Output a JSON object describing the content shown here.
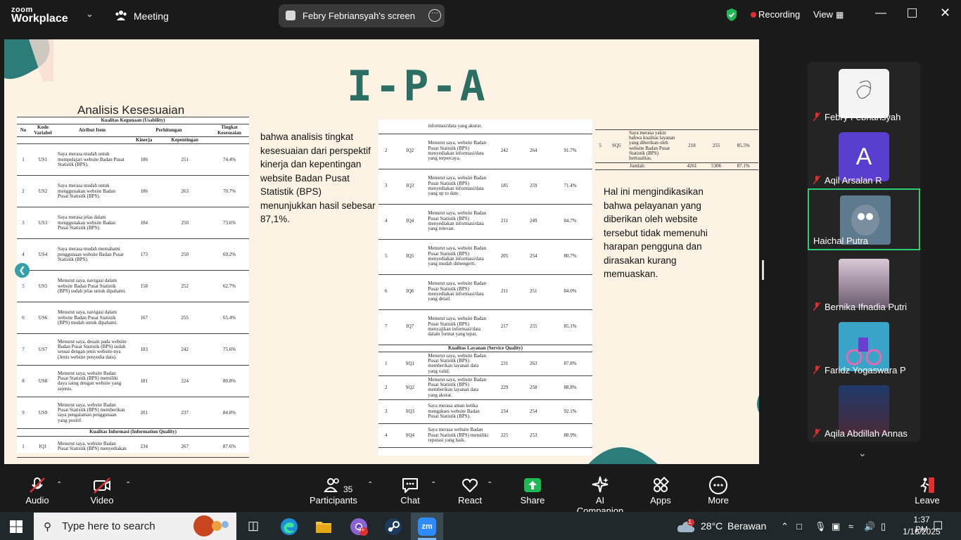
{
  "app": {
    "logo_top": "zoom",
    "logo_bottom": "Workplace",
    "meeting_label": "Meeting",
    "share_label": "Febry Febriansyah's screen",
    "recording_label": "Recording",
    "view_label": "View"
  },
  "slide": {
    "title": "I-P-A",
    "subtitle": "Analisis Kesesuaian",
    "text_left": "bahwa analisis tingkat kesesuaian dari perspektif kinerja dan kepentingan website Badan Pusat Statistik (BPS) menunjukkan hasil sebesar 87,1%.",
    "text_right": "Hal ini mengindikasikan bahwa pelayanan yang diberikan oleh website tersebut tidak memenuhi harapan pengguna dan dirasakan kurang memuaskan.",
    "table1": {
      "section_title": "Kualitas Kegunaan (Usability)",
      "headers": [
        "No",
        "Kode Variabel",
        "Atribut Item",
        "Perhitungan",
        "Tingkat Kesesuaian"
      ],
      "subheaders": [
        "Kinerja",
        "Kepentingan"
      ],
      "rows": [
        {
          "no": "1",
          "code": "US1",
          "item": "Saya merasa mudah untuk mempelajari website Badan Pusat Statistik (BPS).",
          "k": "186",
          "p": "251",
          "t": "74.4%"
        },
        {
          "no": "2",
          "code": "US2",
          "item": "Saya merasa mudah untuk menggunakan website Badan Pusat Statistik (BPS).",
          "k": "186",
          "p": "263",
          "t": "70.7%"
        },
        {
          "no": "3",
          "code": "US3",
          "item": "Saya merasa jelas dalam menggunakan website Badan Pusat Statistik (BPS).",
          "k": "184",
          "p": "250",
          "t": "73.6%"
        },
        {
          "no": "4",
          "code": "US4",
          "item": "Saya merasa mudah memahami penggunaan website Badan Pusat Statistik (BPS).",
          "k": "173",
          "p": "250",
          "t": "69.2%"
        },
        {
          "no": "5",
          "code": "US5",
          "item": "Menurut saya, navigasi dalam website Badan Pusat Statistik (BPS) sudah jelas untuk dipahami.",
          "k": "158",
          "p": "252",
          "t": "62.7%"
        },
        {
          "no": "6",
          "code": "US6",
          "item": "Menurut saya, navigasi dalam website Badan Pusat Statistik (BPS) mudah untuk dipahami.",
          "k": "167",
          "p": "255",
          "t": "65.4%"
        },
        {
          "no": "7",
          "code": "US7",
          "item": "Menurut saya, desain pada website Badan Pusat Statistik (BPS) sudah sesuai dengan jenis website-nya (Jenis website penyedia data).",
          "k": "183",
          "p": "242",
          "t": "75.6%"
        },
        {
          "no": "8",
          "code": "US8",
          "item": "Menurut saya, website Badan Pusat Statistik (BPS) memiliki daya saing dengan website yang sejenis.",
          "k": "181",
          "p": "224",
          "t": "80.8%"
        },
        {
          "no": "9",
          "code": "US9",
          "item": "Menurut saya, website Badan Pusat Statistik (BPS) memberikan saya pengalaman penggunaan yang positif.",
          "k": "201",
          "p": "237",
          "t": "84.8%"
        }
      ],
      "section2_title": "Kualitas Informasi (Information Quality)",
      "rows2": [
        {
          "no": "1",
          "code": "IQ1",
          "item": "Menurut saya, website Badan Pusat Statistik (BPS) menyediakan",
          "k": "234",
          "p": "267",
          "t": "87.6%"
        }
      ]
    },
    "table2": {
      "top_fragment": "informasi/data yang akurat.",
      "rows": [
        {
          "no": "2",
          "code": "IQ2",
          "item": "Menurut saya, website Badan Pusat Statistik (BPS) menyediakan informasi/data yang terpercaya.",
          "k": "242",
          "p": "264",
          "t": "91.7%"
        },
        {
          "no": "3",
          "code": "IQ3",
          "item": "Menurut saya, website Badan Pusat Statistik (BPS) menyediakan informasi/data yang up to date.",
          "k": "185",
          "p": "259",
          "t": "71.4%"
        },
        {
          "no": "4",
          "code": "IQ4",
          "item": "Menurut saya, website Badan Pusat Statistik (BPS) menyediakan informasi/data yang relevan.",
          "k": "211",
          "p": "249",
          "t": "84.7%"
        },
        {
          "no": "5",
          "code": "IQ5",
          "item": "Menurut saya, website Badan Pusat Statistik (BPS) menyediakan informasi/data yang mudah dimengerti.",
          "k": "205",
          "p": "254",
          "t": "80.7%"
        },
        {
          "no": "6",
          "code": "IQ6",
          "item": "Menurut saya, website Badan Pusat Statistik (BPS) menyediakan informasi/data yang detail.",
          "k": "211",
          "p": "251",
          "t": "84.0%"
        },
        {
          "no": "7",
          "code": "IQ7",
          "item": "Menurut saya, website Badan Pusat Statistik (BPS) menyajikan informasi/data dalam format yang tepat.",
          "k": "217",
          "p": "255",
          "t": "85.1%"
        }
      ],
      "section_title": "Kualitas Layanan (Service Quality)",
      "rows2": [
        {
          "no": "1",
          "code": "SQ1",
          "item": "Menurut saya, website Badan Pusat Statistik (BPS) memberikan layanan data yang valid.",
          "k": "231",
          "p": "263",
          "t": "87.8%"
        },
        {
          "no": "2",
          "code": "SQ2",
          "item": "Menurut saya, website Badan Pusat Statistik (BPS) memberikan layanan data yang akurat.",
          "k": "229",
          "p": "258",
          "t": "88.8%"
        },
        {
          "no": "3",
          "code": "SQ3",
          "item": "Saya merasa aman ketika mengakses website Badan Pusat Statistik (BPS).",
          "k": "234",
          "p": "254",
          "t": "92.1%"
        },
        {
          "no": "4",
          "code": "SQ4",
          "item": "Saya merasa website Badan Pusat Statistik (BPS) memiliki reputasi yang baik.",
          "k": "225",
          "p": "253",
          "t": "88.9%"
        }
      ]
    },
    "table3": {
      "rows": [
        {
          "no": "5",
          "code": "SQ5",
          "item": "Saya merasa yakin bahwa kualitas layanan yang diberikan oleh website Badan Pusat Statistik (BPS) berkualitas.",
          "k": "218",
          "p": "255",
          "t": "85.5%"
        }
      ],
      "total_label": "Jumlah:",
      "total_k": "4261",
      "total_p": "5306",
      "total_t": "87.1%"
    }
  },
  "participants_gallery": [
    {
      "name": "Febry Febriansyah",
      "muted": true,
      "thumb": "sketch"
    },
    {
      "name": "Aqil Arsalan R",
      "muted": true,
      "thumb": "letter-A",
      "initial": "A",
      "color": "#5a3ed0"
    },
    {
      "name": "Haichal Putra",
      "muted": false,
      "thumb": "cartoon",
      "active": true
    },
    {
      "name": "Bernika Ifnadia Putri",
      "muted": true,
      "thumb": "photo"
    },
    {
      "name": "Faridz Yogaswara P",
      "muted": true,
      "thumb": "cartoon-bike"
    },
    {
      "name": "Aqila Abdillah Annas",
      "muted": true,
      "thumb": "photo-night"
    }
  ],
  "controls": {
    "audio": "Audio",
    "video": "Video",
    "participants": "Participants",
    "participants_count": "35",
    "chat": "Chat",
    "react": "React",
    "share": "Share",
    "ai": "AI Companion",
    "apps": "Apps",
    "more": "More",
    "leave": "Leave"
  },
  "taskbar": {
    "search_placeholder": "Type here to search",
    "weather_temp": "28°C",
    "weather_text": "Berawan",
    "weather_badge": "1",
    "time": "1:37 PM",
    "date": "1/16/2025",
    "zoom_label": "zm",
    "chrome_badge": "9+"
  },
  "colors": {
    "accent_green": "#2ecc71",
    "record_red": "#e02f2f",
    "slide_bg": "#fcf3e4",
    "title_teal": "#2c6e64",
    "share_green": "#1db954"
  }
}
